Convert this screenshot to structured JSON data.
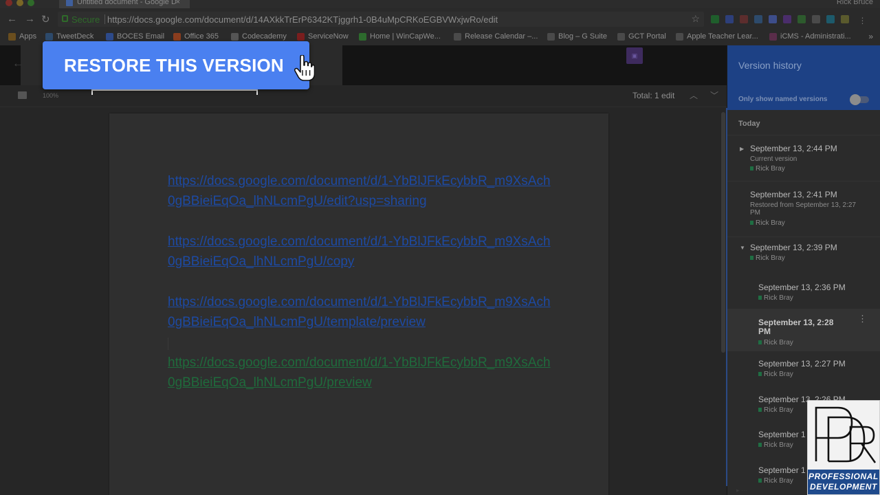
{
  "browser": {
    "tab_title": "Untitled document - Google D",
    "user": "Rick Bruce",
    "secure_label": "Secure",
    "url": "https://docs.google.com/document/d/14AXkkTrErP6342KTjggrh1-0B4uMpCRKoEGBVWxjwRo/edit"
  },
  "bookmarks": [
    "Apps",
    "TweetDeck",
    "BOCES Email",
    "Office 365",
    "Codecademy",
    "ServiceNow",
    "Home | WinCapWe...",
    "Release Calendar –...",
    "Blog – G Suite",
    "GCT Portal",
    "Apple Teacher Lear...",
    "iCMS - Administrati..."
  ],
  "callout": {
    "label": "RESTORE THIS VERSION"
  },
  "toolbar": {
    "zoom": "100%",
    "total": "Total: 1 edit"
  },
  "document": {
    "links": [
      "https://docs.google.com/document/d/1-YbBlJFkEcybbR_m9XsAch0gBBieiEqOa_lhNLcmPgU/edit?usp=sharing",
      "https://docs.google.com/document/d/1-YbBlJFkEcybbR_m9XsAch0gBBieiEqOa_lhNLcmPgU/copy",
      "https://docs.google.com/document/d/1-YbBlJFkEcybbR_m9XsAch0gBBieiEqOa_lhNLcmPgU/template/preview",
      "https://docs.google.com/document/d/1-YbBlJFkEcybbR_m9XsAch0gBBieiEqOa_lhNLcmPgU/preview"
    ]
  },
  "version_history": {
    "title": "Version history",
    "toggle_label": "Only show named versions",
    "section": "Today",
    "versions": [
      {
        "date": "September 13, 2:44 PM",
        "note": "Current version",
        "author": "Rick Bray"
      },
      {
        "date": "September 13, 2:41 PM",
        "note": "Restored from September 13, 2:27 PM",
        "author": "Rick Bray"
      },
      {
        "date": "September 13, 2:39 PM",
        "note": "",
        "author": "Rick Bray"
      },
      {
        "date": "September 13, 2:36 PM",
        "note": "",
        "author": "Rick Bray"
      },
      {
        "date": "September 13, 2:28 PM",
        "note": "",
        "author": "Rick Bray"
      },
      {
        "date": "September 13, 2:27 PM",
        "note": "",
        "author": "Rick Bray"
      },
      {
        "date": "September 13, 2:26 PM",
        "note": "",
        "author": "Rick Bray"
      },
      {
        "date": "September 1",
        "note": "",
        "author": "Rick Bray"
      },
      {
        "date": "September 1",
        "note": "",
        "author": "Rick Bray"
      }
    ]
  },
  "logo": {
    "line1": "PROFESSIONAL",
    "line2": "DEVELOPMENT"
  },
  "colors": {
    "accent": "#4a80f0",
    "panel_header": "#1d4185",
    "link": "#1d4aa3",
    "link_green": "#1f6b3c"
  }
}
